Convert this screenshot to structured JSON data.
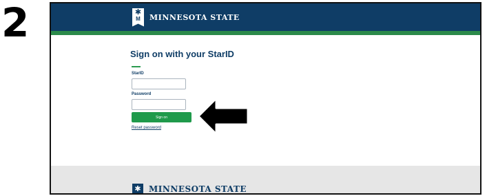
{
  "step": {
    "number": "2"
  },
  "header": {
    "logo_text": "MINNESOTA STATE",
    "logo_mark_letter": "M",
    "logo_star_glyph": "✱",
    "brand_color": "#0f3d66",
    "stripe_color": "#2b8a4a"
  },
  "form": {
    "title": "Sign on with your StarID",
    "starid_label": "StarID",
    "starid_value": "",
    "password_label": "Password",
    "password_value": "",
    "signon_label": "Sign on",
    "reset_label": "Reset password",
    "button_color": "#1f9a4b"
  },
  "footer": {
    "logo_text": "MINNESOTA STATE",
    "logo_star_glyph": "✱"
  },
  "annotation": {
    "icon": "arrow-left-icon"
  }
}
